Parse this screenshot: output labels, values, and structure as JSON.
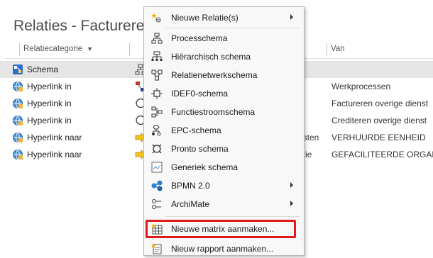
{
  "window": {
    "title": "Relaties - Factureren"
  },
  "columns": {
    "relatiecategorie": "Relatiecategorie",
    "van": "Van"
  },
  "rows": [
    {
      "type": "Schema",
      "icon": "schema-icon",
      "spill": "",
      "van": ""
    },
    {
      "type": "Hyperlink in",
      "icon": "hyperlink-icon",
      "spill": "",
      "van": "Werkprocessen"
    },
    {
      "type": "Hyperlink in",
      "icon": "hyperlink-icon",
      "spill": "",
      "van": "Factureren overige dienst"
    },
    {
      "type": "Hyperlink in",
      "icon": "hyperlink-icon",
      "spill": "",
      "van": "Crediteren overige dienst"
    },
    {
      "type": "Hyperlink naar",
      "icon": "hyperlink-icon",
      "spill": "osten",
      "van": "VERHUURDE EENHEID"
    },
    {
      "type": "Hyperlink naar",
      "icon": "hyperlink-icon",
      "spill": "atie",
      "van": "GEFACILITEERDE ORGANIS"
    }
  ],
  "menu": {
    "items": [
      {
        "label": "Nieuwe Relatie(s)",
        "icon": "new-relation-icon",
        "submenu": true
      },
      {
        "label": "Processchema",
        "icon": "process-schema-icon",
        "submenu": false
      },
      {
        "label": "Hiërarchisch schema",
        "icon": "hierarchical-schema-icon",
        "submenu": false
      },
      {
        "label": "Relatienetwerkschema",
        "icon": "relation-network-icon",
        "submenu": false
      },
      {
        "label": "IDEF0-schema",
        "icon": "idef0-icon",
        "submenu": false
      },
      {
        "label": "Functiestroomschema",
        "icon": "function-flow-icon",
        "submenu": false
      },
      {
        "label": "EPC-schema",
        "icon": "epc-icon",
        "submenu": false
      },
      {
        "label": "Pronto schema",
        "icon": "pronto-icon",
        "submenu": false
      },
      {
        "label": "Generiek schema",
        "icon": "generic-schema-icon",
        "submenu": false
      },
      {
        "label": "BPMN 2.0",
        "icon": "bpmn-icon",
        "submenu": true
      },
      {
        "label": "ArchiMate",
        "icon": "archimate-icon",
        "submenu": true
      },
      {
        "label": "Nieuwe matrix aanmaken...",
        "icon": "matrix-icon",
        "submenu": false
      },
      {
        "label": "Nieuw rapport aanmaken...",
        "icon": "report-icon",
        "submenu": false
      }
    ]
  },
  "colors": {
    "highlight": "#e0191b",
    "selected_row": "#e5e5e5"
  }
}
